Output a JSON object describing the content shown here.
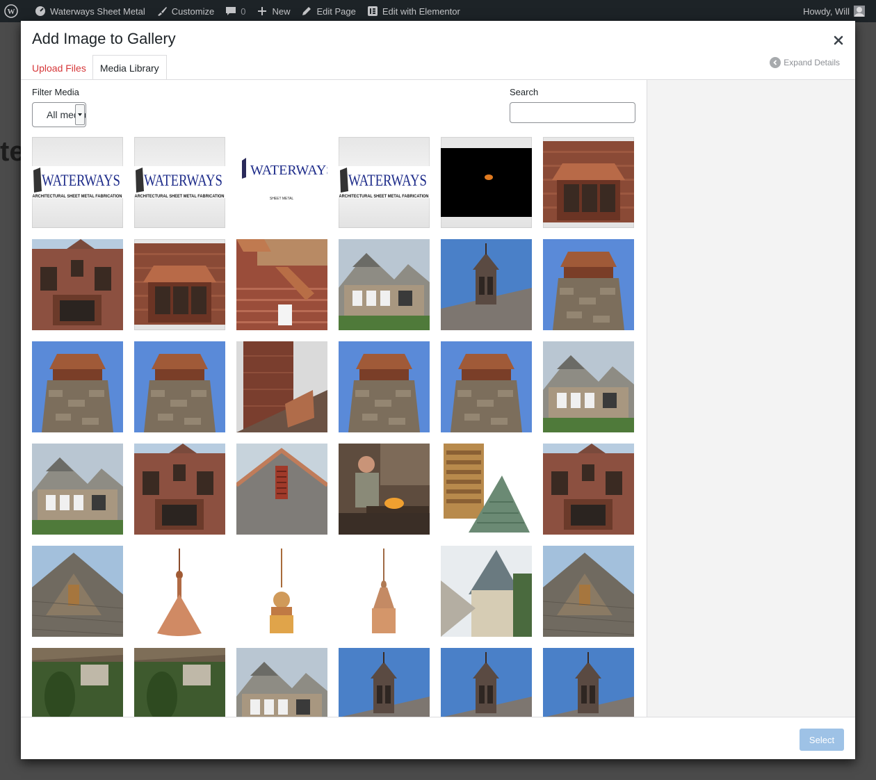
{
  "admin_bar": {
    "site_name": "Waterways Sheet Metal",
    "customize": "Customize",
    "comments_count": "0",
    "new_label": "New",
    "edit_page": "Edit Page",
    "edit_elementor": "Edit with Elementor",
    "howdy": "Howdy, Will"
  },
  "background_text": "te",
  "modal": {
    "title": "Add Image to Gallery",
    "tabs": [
      {
        "label": "Upload Files",
        "active": false
      },
      {
        "label": "Media Library",
        "active": true
      }
    ],
    "expand_details": "Expand Details",
    "filter_label": "Filter Media",
    "filter_value": "All media items",
    "search_label": "Search",
    "search_value": "",
    "select_button": "Select"
  },
  "logo_text": {
    "brand": "WATERWAYS",
    "tagline": "ARCHITECTURAL SHEET METAL FABRICATION",
    "tagline_alt": "SHEET METAL"
  },
  "colors": {
    "accent": "#d63638",
    "primary_disabled": "#9ec2e6",
    "admin_bar": "#1d2327",
    "logo_navy": "#1e2c8a"
  },
  "media_items": [
    {
      "kind": "logo"
    },
    {
      "kind": "logo"
    },
    {
      "kind": "logo-alt"
    },
    {
      "kind": "logo"
    },
    {
      "kind": "night"
    },
    {
      "kind": "house-bay"
    },
    {
      "kind": "house-brick"
    },
    {
      "kind": "house-bay"
    },
    {
      "kind": "gutter"
    },
    {
      "kind": "house-stone"
    },
    {
      "kind": "cupola"
    },
    {
      "kind": "chimney-cap"
    },
    {
      "kind": "chimney-cap"
    },
    {
      "kind": "chimney-cap"
    },
    {
      "kind": "chimney-brick"
    },
    {
      "kind": "chimney-cap"
    },
    {
      "kind": "chimney-cap"
    },
    {
      "kind": "house-stone"
    },
    {
      "kind": "house-stone"
    },
    {
      "kind": "house-brick"
    },
    {
      "kind": "gable"
    },
    {
      "kind": "workshop"
    },
    {
      "kind": "louver"
    },
    {
      "kind": "house-brick"
    },
    {
      "kind": "roof"
    },
    {
      "kind": "finial-cone"
    },
    {
      "kind": "finial-ball"
    },
    {
      "kind": "finial-box"
    },
    {
      "kind": "turret"
    },
    {
      "kind": "roof"
    },
    {
      "kind": "garden"
    },
    {
      "kind": "garden"
    },
    {
      "kind": "house-stone"
    },
    {
      "kind": "cupola"
    },
    {
      "kind": "cupola"
    },
    {
      "kind": "cupola"
    }
  ]
}
